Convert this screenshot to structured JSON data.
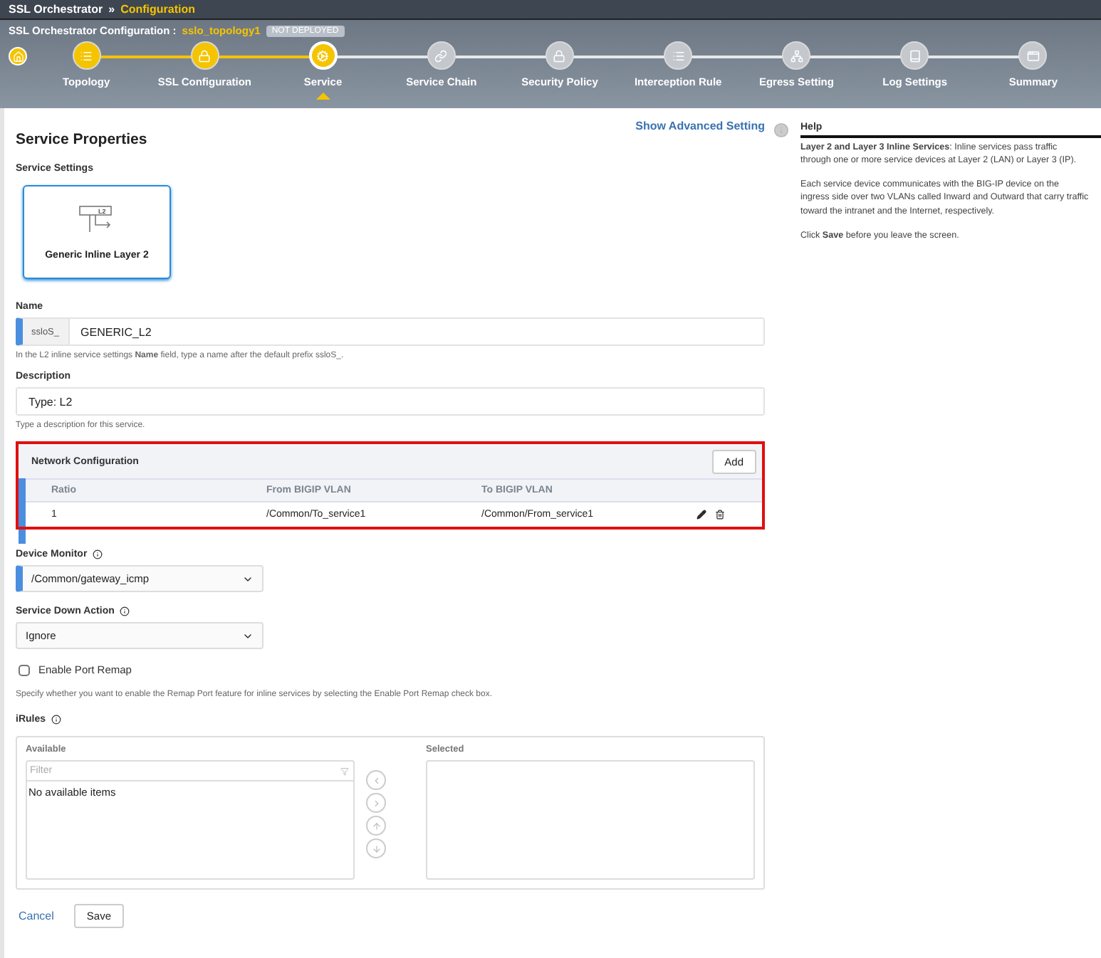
{
  "breadcrumb": {
    "root": "SSL Orchestrator",
    "separator": "»",
    "current": "Configuration"
  },
  "config_bar": {
    "label": "SSL Orchestrator Configuration :",
    "topology": "sslo_topology1",
    "status_badge": "NOT DEPLOYED"
  },
  "steps": [
    {
      "label": "Topology",
      "completed": true,
      "selected": false
    },
    {
      "label": "SSL Configuration",
      "completed": true,
      "selected": false
    },
    {
      "label": "Service",
      "completed": false,
      "selected": true
    },
    {
      "label": "Service Chain",
      "completed": false,
      "selected": false
    },
    {
      "label": "Security Policy",
      "completed": false,
      "selected": false
    },
    {
      "label": "Interception Rule",
      "completed": false,
      "selected": false
    },
    {
      "label": "Egress Setting",
      "completed": false,
      "selected": false
    },
    {
      "label": "Log Settings",
      "completed": false,
      "selected": false
    },
    {
      "label": "Summary",
      "completed": false,
      "selected": false
    }
  ],
  "page_title": "Service Properties",
  "advanced_link": "Show Advanced Setting",
  "service_settings": {
    "label": "Service Settings",
    "card": "Generic Inline Layer 2",
    "card_icon_text": "L2",
    "selected": true
  },
  "name_field": {
    "label": "Name",
    "prefix": "ssloS_",
    "value": "GENERIC_L2",
    "required": true,
    "hint": "In the L2 inline service settings **Name** field, type a name after the default prefix ssloS_."
  },
  "description_field": {
    "label": "Description",
    "value": "Type: L2",
    "hint": "Type a description for this service."
  },
  "network_configuration": {
    "title": "Network Configuration",
    "highlighted": true,
    "add_button": "Add",
    "columns": [
      "Ratio",
      "From BIGIP VLAN",
      "To BIGIP VLAN"
    ],
    "rows": [
      {
        "cells": [
          "1",
          "/Common/To_service1",
          "/Common/From_service1"
        ]
      }
    ]
  },
  "device_monitor": {
    "label": "Device Monitor",
    "value": "/Common/gateway_icmp",
    "required": true
  },
  "service_down_action": {
    "label": "Service Down Action",
    "value": "Ignore",
    "required": false
  },
  "port_remap": {
    "label": "Enable Port Remap",
    "checked": false,
    "hint": "Specify whether you want to enable the Remap Port feature for inline services by selecting the Enable Port Remap check box."
  },
  "irules": {
    "label": "iRules",
    "available_label": "Available",
    "filter_placeholder": "Filter",
    "empty_text": "No available items",
    "selected_label": "Selected"
  },
  "footer": {
    "cancel": "Cancel",
    "save": "Save"
  },
  "help": {
    "title": "Help",
    "paragraphs": [
      "**Layer 2 and Layer 3 Inline Services**: Inline services pass traffic through one or more service devices at Layer 2 (LAN) or Layer 3 (IP).",
      "Each service device communicates with the BIG-IP device on the ingress side over two VLANs called Inward and Outward that carry traffic toward the intranet and the Internet, respectively.",
      "Click **Save** before you leave the screen."
    ]
  }
}
